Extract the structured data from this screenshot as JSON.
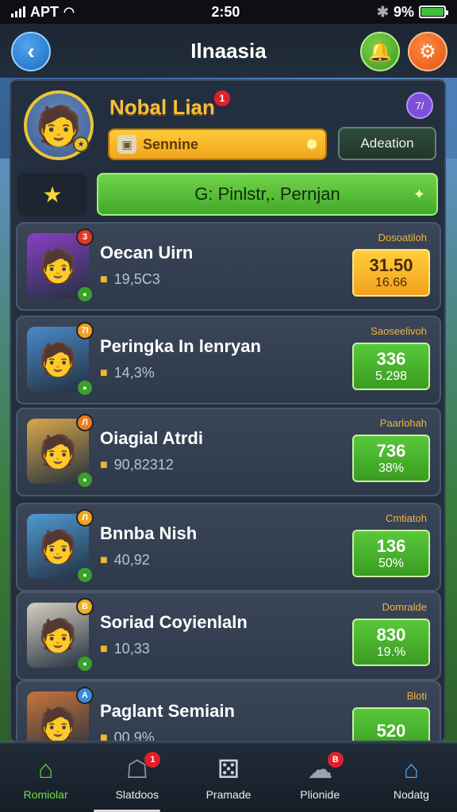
{
  "status_bar": {
    "carrier": "APT",
    "time": "2:50",
    "battery": "9%"
  },
  "header": {
    "title": "Ilnaasia"
  },
  "profile": {
    "name": "Nobal Lian",
    "notification_count": "1",
    "rank_badge": "7/",
    "season_label": "Sennine",
    "action_label": "Adeation"
  },
  "filter": {
    "label": "G: Pinlstr,. Pernjan"
  },
  "players": [
    {
      "name": "Oecan Uirn",
      "sub": "19,5С3",
      "label": "Dosoatiloh",
      "score1": "31.50",
      "score2": "16.66",
      "score_style": "gold",
      "avatar_color": "#8a3fc4",
      "corner": "3",
      "corner_color": "#e0382a"
    },
    {
      "name": "Peringka In lenryan",
      "sub": "14,3%",
      "label": "Saoseelivoh",
      "score1": "336",
      "score2": "5.298",
      "score_style": "green",
      "avatar_color": "#4a8ac8",
      "corner": "7І",
      "corner_color": "#f0a21c"
    },
    {
      "name": "Oiagial Atrdi",
      "sub": "90,82312",
      "label": "Paarlohah",
      "score1": "736",
      "score2": "38%",
      "score_style": "green",
      "avatar_color": "#d9a84a",
      "corner": "Л",
      "corner_color": "#f07a1c"
    },
    {
      "name": "Bnnba Nish",
      "sub": "40,92",
      "label": "Cmtiatoh",
      "score1": "136",
      "score2": "50%",
      "score_style": "green",
      "avatar_color": "#4f9ad4",
      "corner": "Л",
      "corner_color": "#f0a21c"
    },
    {
      "name": "Soriad Coyienlaln",
      "sub": "10,33",
      "label": "Domralde",
      "score1": "830",
      "score2": "19.%",
      "score_style": "green",
      "avatar_color": "#d6cfc0",
      "corner": "B",
      "corner_color": "#f0b21c"
    },
    {
      "name": "Paglant Semiain",
      "sub": "00.9%",
      "label": "Bloti",
      "score1": "520",
      "score2": "",
      "score_style": "green",
      "avatar_color": "#c8743a",
      "corner": "А",
      "corner_color": "#3a8ad8"
    }
  ],
  "nav": [
    {
      "label": "Romiolar",
      "icon": "home-icon",
      "glyph": "⌂",
      "color": "#5bd03a",
      "badge": ""
    },
    {
      "label": "Slatdoos",
      "icon": "shop-icon",
      "glyph": "☖",
      "color": "#8a9aaa",
      "badge": "1"
    },
    {
      "label": "Pramade",
      "icon": "dice-icon",
      "glyph": "⚄",
      "color": "#c8d0d8",
      "badge": ""
    },
    {
      "label": "Plionide",
      "icon": "chat-icon",
      "glyph": "☁",
      "color": "#9aa4b0",
      "badge": "B"
    },
    {
      "label": "Nodatg",
      "icon": "house-icon",
      "glyph": "⌂",
      "color": "#4fa6ee",
      "badge": ""
    }
  ],
  "colors": {
    "accent_green": "#5bd03a",
    "accent_gold": "#f5c03a",
    "panel_bg": "#222c3a"
  }
}
